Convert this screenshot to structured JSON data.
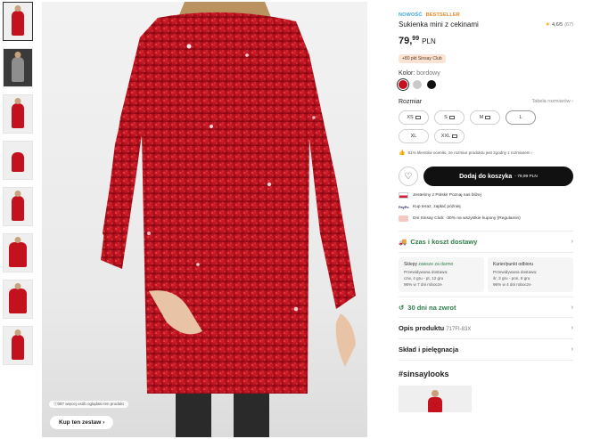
{
  "gallery": {
    "thumbnails": [
      {
        "name": "thumb-1",
        "color": "#c4111e"
      },
      {
        "name": "thumb-2",
        "color": "#8e8e8e"
      },
      {
        "name": "thumb-3",
        "color": "#c4111e"
      },
      {
        "name": "thumb-4",
        "color": "#c4111e"
      },
      {
        "name": "thumb-5",
        "color": "#c4111e"
      },
      {
        "name": "thumb-6",
        "color": "#c4111e"
      },
      {
        "name": "thumb-7",
        "color": "#c4111e"
      },
      {
        "name": "thumb-8",
        "color": "#c4111e"
      }
    ],
    "image_note": "ⓢ087 więcej osób oglądało ten produkt",
    "shop_look_label": "Kup ten zestaw",
    "shop_look_arrow": "›"
  },
  "product": {
    "tag_new": "NOWOŚĆ",
    "tag_best": "BESTSELLER",
    "title": "Sukienka mini z cekinami",
    "rating_star": "★",
    "rating_value": "4,6/5",
    "rating_count": "(67)",
    "price_main": "79,",
    "price_cents": "99",
    "price_currency": "PLN",
    "club_badge": "+80 pkt Sinsay Club",
    "color_label": "Kolor:",
    "color_value": "bordowy",
    "swatches": [
      "#c4111e",
      "#c9c9c9",
      "#111111"
    ],
    "size_label": "Rozmiar",
    "size_guide": "Tabela rozmiarów ›",
    "sizes": [
      "XS",
      "S",
      "M",
      "L",
      "XL",
      "XXL"
    ],
    "fit_note": "81% klientów oceniło, że rozmiar produktu jest zgodny z rozmiarem ›",
    "fit_icon": "👍",
    "heart_icon": "♡",
    "add_to_cart": "Dodaj do koszyka",
    "add_to_cart_price": "- 79,99 PLN",
    "info_lines": [
      {
        "text": "Jesteśmy z Polski! Poznaj nas bliżej"
      },
      {
        "text": "Kup teraz, zapłać później",
        "icon_text": "PayPo"
      },
      {
        "text": "Dni Sinsay Club: -30% na wszystkie kupony (Regulamin)"
      }
    ],
    "delivery_heading": "Czas i koszt dostawy",
    "delivery_chevron": "›",
    "delivery_cols": [
      {
        "head_a": "Sklepy ",
        "head_b": "zawsze za darmo",
        "l1": "Przewidywana dostawa:",
        "l2": "czw, 4 gru - pt, 12 gru",
        "l3": "96% w 7 dni robocze"
      },
      {
        "head_a": "Kurier/punkt odbioru",
        "head_b": "",
        "l1": "Przewidywana dostawa:",
        "l2": "śr, 3 gru - pon, 8 gru",
        "l3": "96% w 4 dni robocze"
      }
    ],
    "returns": "30 dni na zwrot",
    "description_label": "Opis produktu",
    "description_code": "717FI-83X",
    "care_label": "Skład i pielęgnacja",
    "chevron": "›",
    "hashtag": "#sinsaylooks"
  }
}
